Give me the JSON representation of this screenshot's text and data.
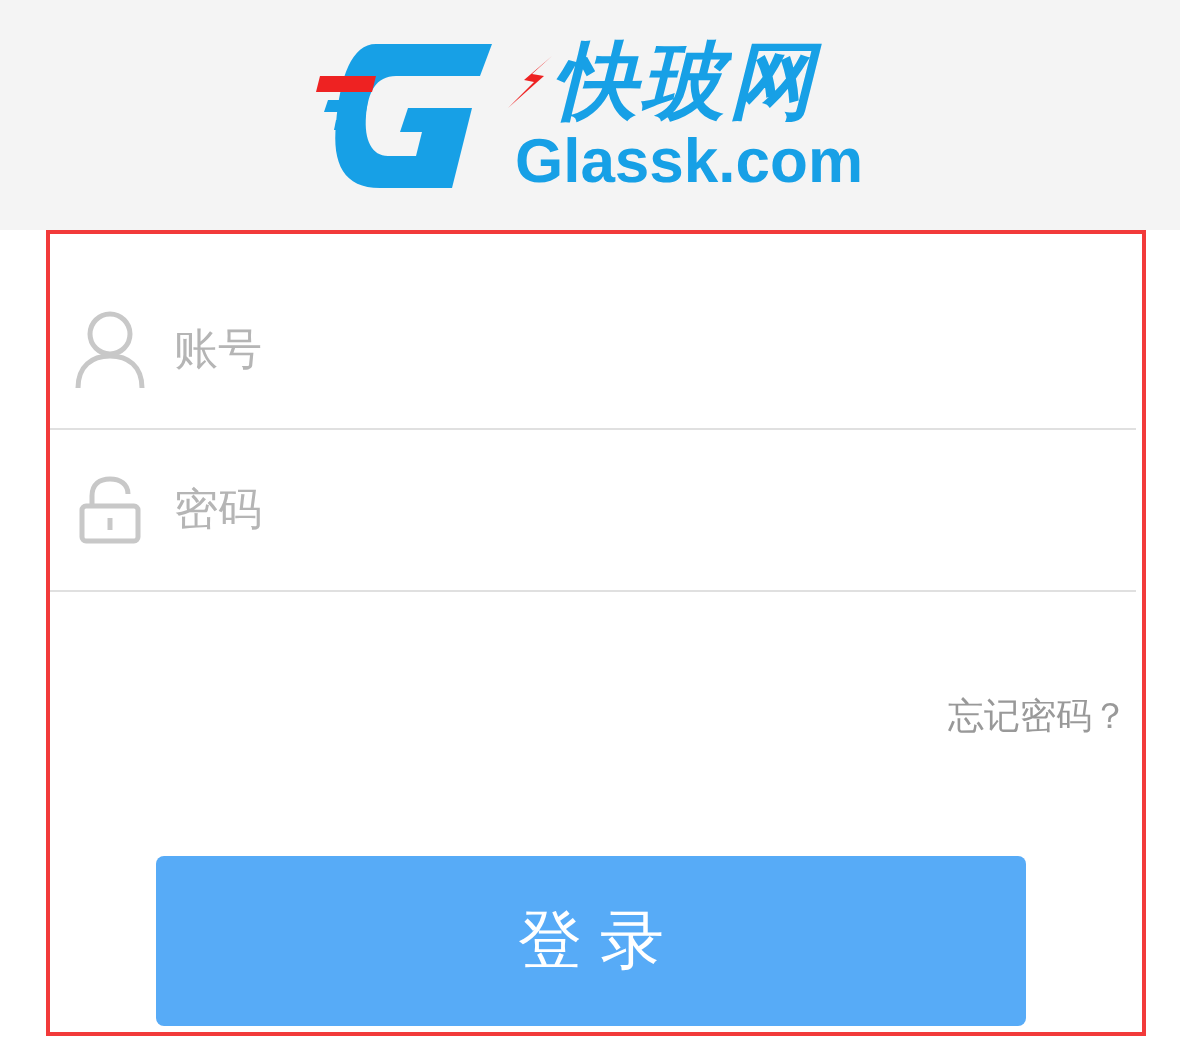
{
  "header": {
    "brand_name": "快玻网",
    "domain": "Glassk.com"
  },
  "login_form": {
    "fields": [
      {
        "kind": "user",
        "placeholder": "账号"
      },
      {
        "kind": "lock",
        "placeholder": "密码"
      }
    ],
    "forgot_link": "忘记密码？",
    "submit_button": "登 录"
  }
}
